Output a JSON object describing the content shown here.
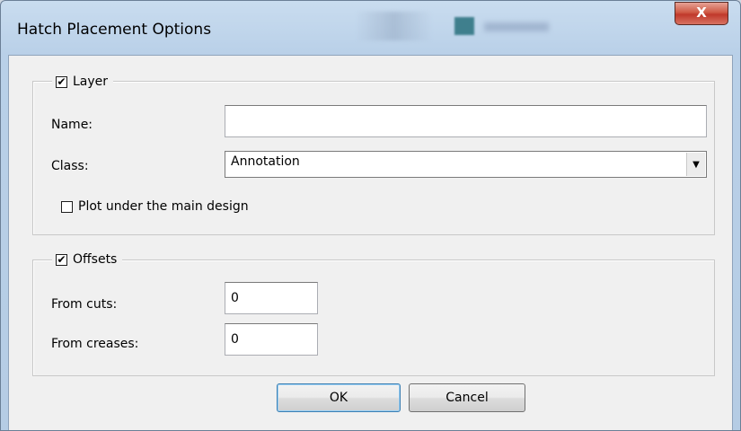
{
  "window": {
    "title": "Hatch Placement Options",
    "close_glyph": "X"
  },
  "layer_group": {
    "checkbox_label": "Layer",
    "checked": true,
    "name_label": "Name:",
    "name_value": "",
    "class_label": "Class:",
    "class_value": "Annotation",
    "plot_under_label": "Plot under the main design",
    "plot_under_checked": false
  },
  "offsets_group": {
    "checkbox_label": "Offsets",
    "checked": true,
    "from_cuts_label": "From cuts:",
    "from_cuts_value": "0",
    "from_creases_label": "From creases:",
    "from_creases_value": "0"
  },
  "buttons": {
    "ok_label": "OK",
    "cancel_label": "Cancel"
  },
  "glyphs": {
    "check": "✔",
    "dropdown_arrow": "▼"
  }
}
